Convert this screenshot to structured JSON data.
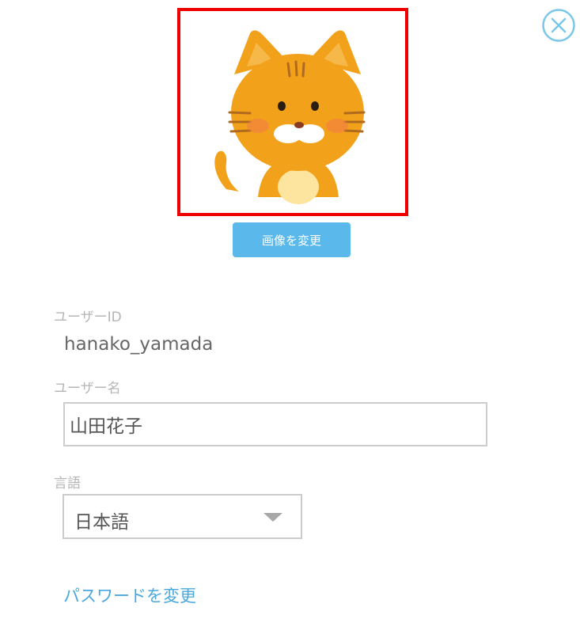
{
  "header": {
    "close_icon": "close-circle-icon",
    "accent_color": "#5bb8ea"
  },
  "avatar": {
    "image": "orange-tabby-cat-illustration",
    "border_color": "#ee0000",
    "change_button_label": "画像を変更"
  },
  "form": {
    "user_id": {
      "label": "ユーザーID",
      "value": "hanako_yamada"
    },
    "user_name": {
      "label": "ユーザー名",
      "value": "山田花子"
    },
    "language": {
      "label": "言語",
      "selected": "日本語",
      "arrow_icon": "dropdown-triangle-icon"
    }
  },
  "footer": {
    "change_password_link": "パスワードを変更"
  }
}
